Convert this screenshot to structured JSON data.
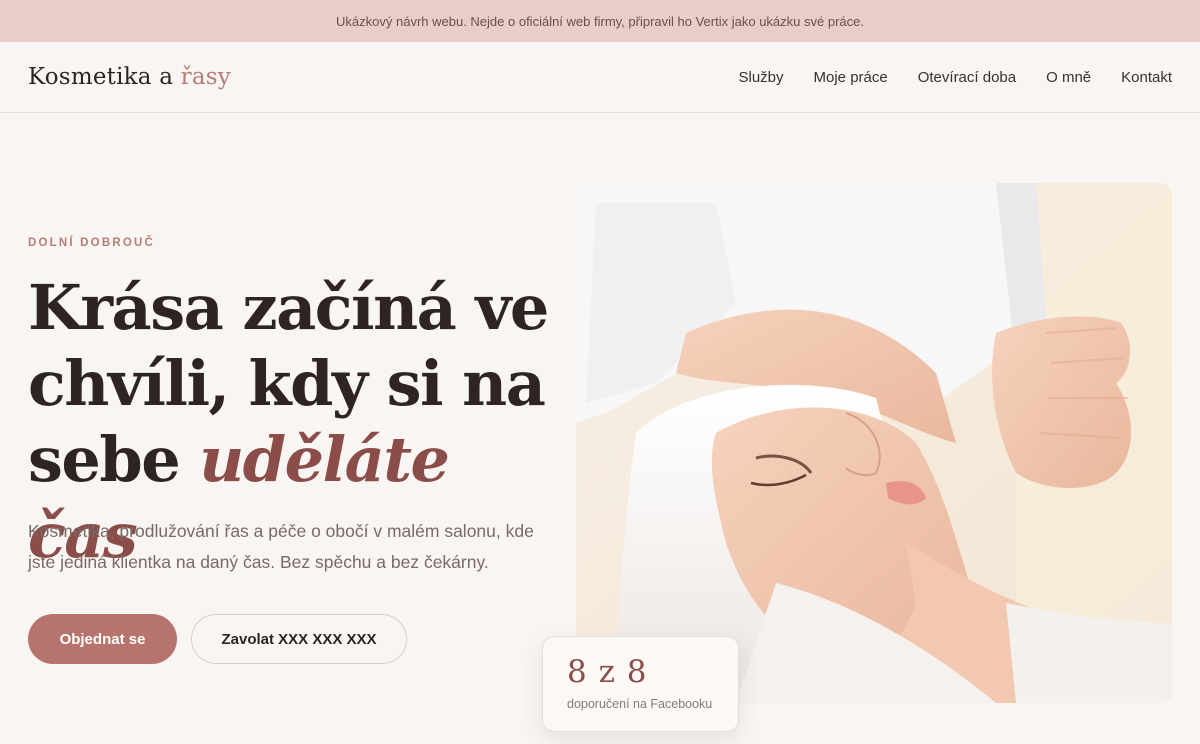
{
  "notice": {
    "text": "Ukázkový návrh webu. Nejde o oficiální web firmy, připravil ho Vertix jako ukázku své práce."
  },
  "header": {
    "logo_main": "Kosmetika a ",
    "logo_accent": "řasy",
    "nav": [
      {
        "label": "Služby"
      },
      {
        "label": "Moje práce"
      },
      {
        "label": "Otevírací doba"
      },
      {
        "label": "O mně"
      },
      {
        "label": "Kontakt"
      }
    ]
  },
  "hero": {
    "eyebrow": "DOLNÍ DOBROUČ",
    "headline_line1": "Krása začíná ve",
    "headline_line2": "chvíli, kdy si na",
    "headline_line3_plain": "sebe ",
    "headline_line3_accent": "uděláte čas",
    "lead": "Kosmetika, prodlužování řas a péče o obočí v malém salonu, kde jste jediná klientka na daný čas. Bez spěchu a bez čekárny.",
    "primary_button": "Objednat se",
    "secondary_button": "Zavolat XXX XXX XXX"
  },
  "rating": {
    "value": "8 z 8",
    "label": "doporučení na Facebooku"
  },
  "colors": {
    "accent": "#b77c76",
    "accent_dark": "#8a4d49",
    "topbar": "#e8cdc8",
    "background": "#f9f5f2"
  }
}
